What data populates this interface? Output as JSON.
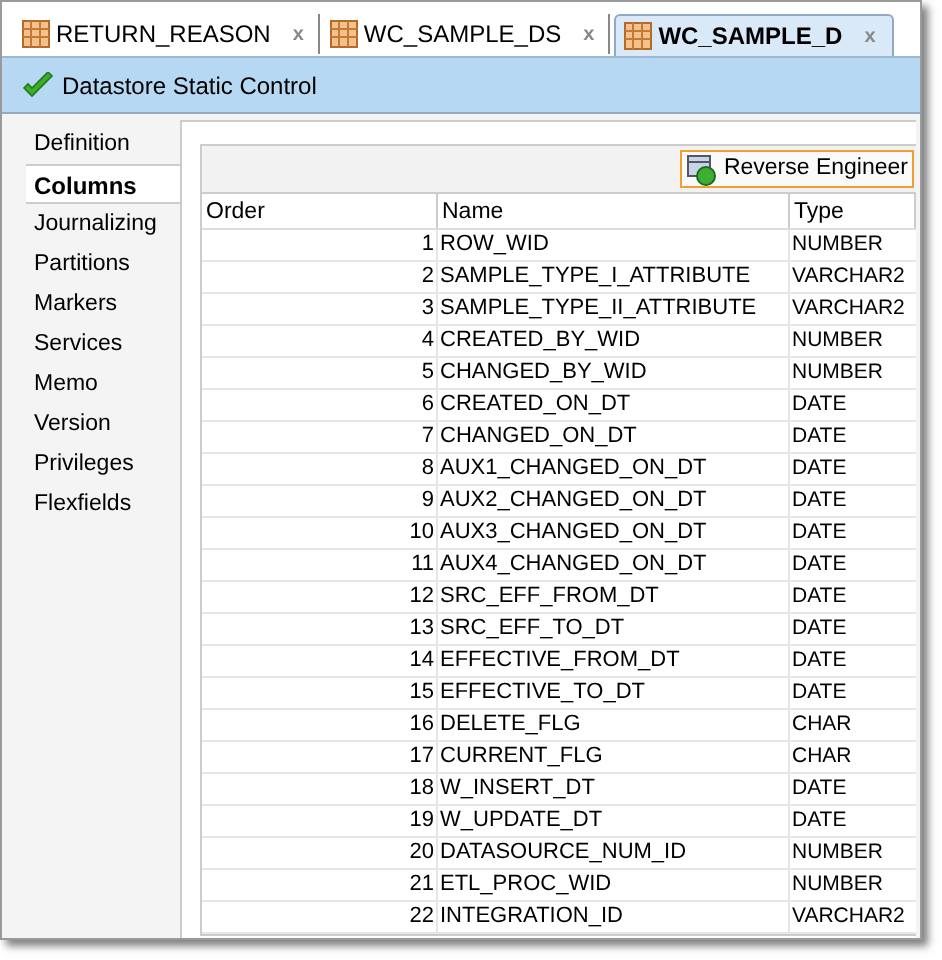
{
  "tabs": [
    {
      "label": "RETURN_REASON",
      "selected": false,
      "close": "x"
    },
    {
      "label": "WC_SAMPLE_DS",
      "selected": false,
      "close": "x"
    },
    {
      "label": "WC_SAMPLE_D",
      "selected": true,
      "close": "x"
    }
  ],
  "status": {
    "text": "Datastore Static Control"
  },
  "sidebar": {
    "items": [
      {
        "label": "Definition",
        "selected": false
      },
      {
        "label": "Columns",
        "selected": true
      },
      {
        "label": "Journalizing",
        "selected": false
      },
      {
        "label": "Partitions",
        "selected": false
      },
      {
        "label": "Markers",
        "selected": false
      },
      {
        "label": "Services",
        "selected": false
      },
      {
        "label": "Memo",
        "selected": false
      },
      {
        "label": "Version",
        "selected": false
      },
      {
        "label": "Privileges",
        "selected": false
      },
      {
        "label": "Flexfields",
        "selected": false
      }
    ]
  },
  "toolbar": {
    "button": "Reverse Engineer"
  },
  "table": {
    "columns": [
      "Order",
      "Name",
      "Type"
    ],
    "rows": [
      [
        "1",
        "ROW_WID",
        "NUMBER"
      ],
      [
        "2",
        "SAMPLE_TYPE_I_ATTRIBUTE",
        "VARCHAR2"
      ],
      [
        "3",
        "SAMPLE_TYPE_II_ATTRIBUTE",
        "VARCHAR2"
      ],
      [
        "4",
        "CREATED_BY_WID",
        "NUMBER"
      ],
      [
        "5",
        "CHANGED_BY_WID",
        "NUMBER"
      ],
      [
        "6",
        "CREATED_ON_DT",
        "DATE"
      ],
      [
        "7",
        "CHANGED_ON_DT",
        "DATE"
      ],
      [
        "8",
        "AUX1_CHANGED_ON_DT",
        "DATE"
      ],
      [
        "9",
        "AUX2_CHANGED_ON_DT",
        "DATE"
      ],
      [
        "10",
        "AUX3_CHANGED_ON_DT",
        "DATE"
      ],
      [
        "11",
        "AUX4_CHANGED_ON_DT",
        "DATE"
      ],
      [
        "12",
        "SRC_EFF_FROM_DT",
        "DATE"
      ],
      [
        "13",
        "SRC_EFF_TO_DT",
        "DATE"
      ],
      [
        "14",
        "EFFECTIVE_FROM_DT",
        "DATE"
      ],
      [
        "15",
        "EFFECTIVE_TO_DT",
        "DATE"
      ],
      [
        "16",
        "DELETE_FLG",
        "CHAR"
      ],
      [
        "17",
        "CURRENT_FLG",
        "CHAR"
      ],
      [
        "18",
        "W_INSERT_DT",
        "DATE"
      ],
      [
        "19",
        "W_UPDATE_DT",
        "DATE"
      ],
      [
        "20",
        "DATASOURCE_NUM_ID",
        "NUMBER"
      ],
      [
        "21",
        "ETL_PROC_WID",
        "NUMBER"
      ],
      [
        "22",
        "INTEGRATION_ID",
        "VARCHAR2"
      ]
    ]
  }
}
